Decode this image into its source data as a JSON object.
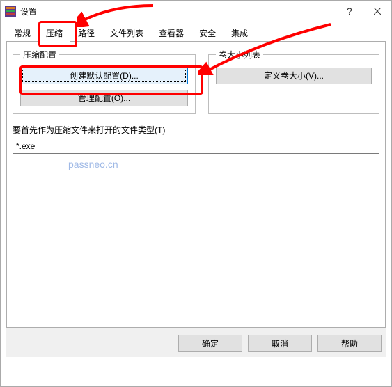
{
  "window": {
    "title": "设置"
  },
  "tabs": {
    "items": [
      {
        "label": "常规"
      },
      {
        "label": "压缩"
      },
      {
        "label": "路径"
      },
      {
        "label": "文件列表"
      },
      {
        "label": "查看器"
      },
      {
        "label": "安全"
      },
      {
        "label": "集成"
      }
    ],
    "active_index": 1
  },
  "groups": {
    "compress": {
      "legend": "压缩配置",
      "create_default": "创建默认配置(D)...",
      "manage": "管理配置(O)..."
    },
    "volumes": {
      "legend": "卷大小列表",
      "define": "定义卷大小(V)..."
    }
  },
  "filetype": {
    "label": "要首先作为压缩文件来打开的文件类型(T)",
    "value": "*.exe"
  },
  "footer": {
    "ok": "确定",
    "cancel": "取消",
    "help": "帮助"
  },
  "watermark": "passneo.cn"
}
